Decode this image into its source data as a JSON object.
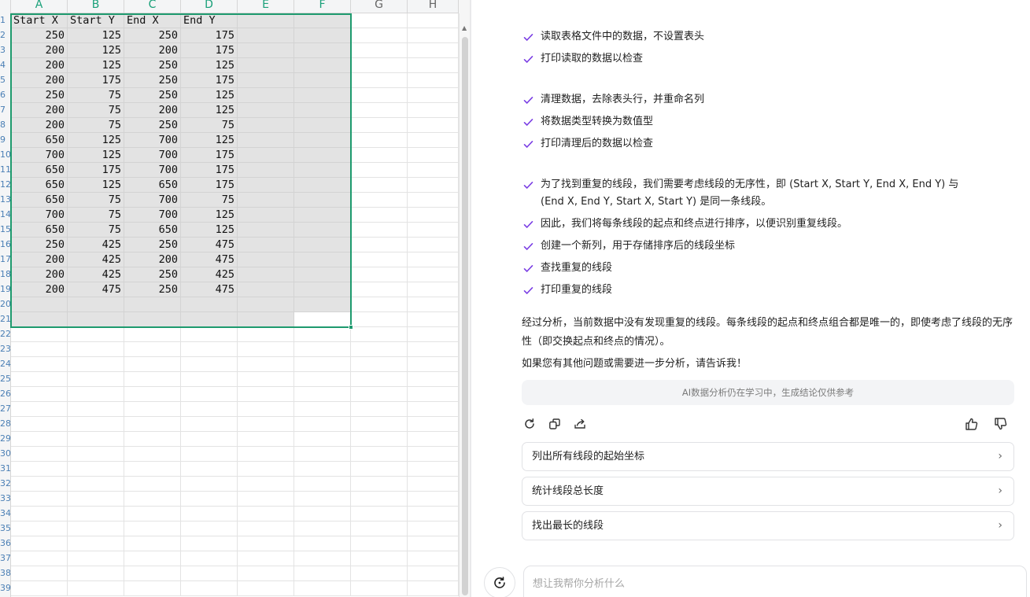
{
  "sheet": {
    "columns": [
      "A",
      "B",
      "C",
      "D",
      "E",
      "F",
      "G",
      "H"
    ],
    "row_numbers": [
      "1",
      "2",
      "3",
      "4",
      "5",
      "6",
      "7",
      "8",
      "9",
      "10",
      "11",
      "12",
      "13",
      "14",
      "15",
      "16",
      "17",
      "18",
      "19",
      "20",
      "21",
      "22",
      "23",
      "24",
      "25",
      "26",
      "27",
      "28",
      "29",
      "30",
      "31",
      "32",
      "33",
      "34",
      "35",
      "36",
      "37",
      "38",
      "39"
    ],
    "rows": [
      [
        "Start X",
        "Start Y",
        "End X",
        "End Y"
      ],
      [
        "250",
        "125",
        "250",
        "175"
      ],
      [
        "200",
        "125",
        "200",
        "175"
      ],
      [
        "200",
        "125",
        "250",
        "125"
      ],
      [
        "200",
        "175",
        "250",
        "175"
      ],
      [
        "250",
        "75",
        "250",
        "125"
      ],
      [
        "200",
        "75",
        "200",
        "125"
      ],
      [
        "200",
        "75",
        "250",
        "75"
      ],
      [
        "650",
        "125",
        "700",
        "125"
      ],
      [
        "700",
        "125",
        "700",
        "175"
      ],
      [
        "650",
        "175",
        "700",
        "175"
      ],
      [
        "650",
        "125",
        "650",
        "175"
      ],
      [
        "650",
        "75",
        "700",
        "75"
      ],
      [
        "700",
        "75",
        "700",
        "125"
      ],
      [
        "650",
        "75",
        "650",
        "125"
      ],
      [
        "250",
        "425",
        "250",
        "475"
      ],
      [
        "200",
        "425",
        "200",
        "475"
      ],
      [
        "200",
        "425",
        "250",
        "425"
      ],
      [
        "200",
        "475",
        "250",
        "475"
      ]
    ],
    "selection": "A1:F21",
    "selection_color": "#1e9a6e"
  },
  "chat": {
    "accent_color": "#7b3fe4",
    "step_groups": [
      [
        "读取表格文件中的数据，不设置表头",
        "打印读取的数据以检查"
      ],
      [
        "清理数据，去除表头行，并重命名列",
        "将数据类型转换为数值型",
        "打印清理后的数据以检查"
      ],
      [
        "为了找到重复的线段，我们需要考虑线段的无序性，即 (Start X, Start Y, End X, End Y) 与 (End X, End Y, Start X, Start Y) 是同一条线段。",
        "因此，我们将每条线段的起点和终点进行排序，以便识别重复线段。",
        "创建一个新列，用于存储排序后的线段坐标",
        "查找重复的线段",
        "打印重复的线段"
      ]
    ],
    "summary": "经过分析，当前数据中没有发现重复的线段。每条线段的起点和终点组合都是唯一的，即使考虑了线段的无序性（即交换起点和终点的情况）。",
    "followup": "如果您有其他问题或需要进一步分析，请告诉我！",
    "disclaimer": "AI数据分析仍在学习中，生成结论仅供参考",
    "toolbar_icons": [
      "refresh-icon",
      "copy-icon",
      "share-icon",
      "thumbs-up-icon",
      "thumbs-down-icon"
    ],
    "suggestions": [
      "列出所有线段的起始坐标",
      "统计线段总长度",
      "找出最长的线段"
    ],
    "input_placeholder": "想让我帮你分析什么"
  }
}
